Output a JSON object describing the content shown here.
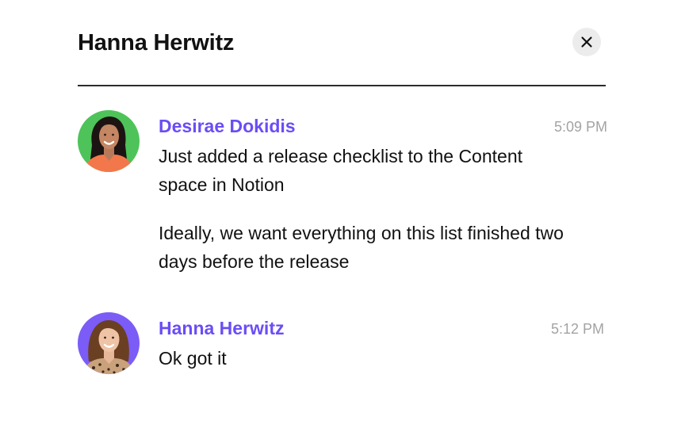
{
  "header": {
    "title": "Hanna Herwitz",
    "close_icon": "close-icon"
  },
  "colors": {
    "accent": "#6b4df5",
    "timestamp": "#a3a3a3",
    "divider": "#2b2b2b",
    "close_bg": "#ececec",
    "avatar1_bg": "#4ec35a",
    "avatar2_bg": "#7b5cf6"
  },
  "messages": [
    {
      "sender": "Desirae Dokidis",
      "time": "5:09 PM",
      "avatar": "avatar-desirae",
      "paragraphs": [
        "Just added a release checklist to the Content space in Notion",
        "Ideally, we want everything on this list finished two days before the release"
      ]
    },
    {
      "sender": "Hanna Herwitz",
      "time": "5:12 PM",
      "avatar": "avatar-hanna",
      "paragraphs": [
        "Ok got it"
      ]
    }
  ]
}
